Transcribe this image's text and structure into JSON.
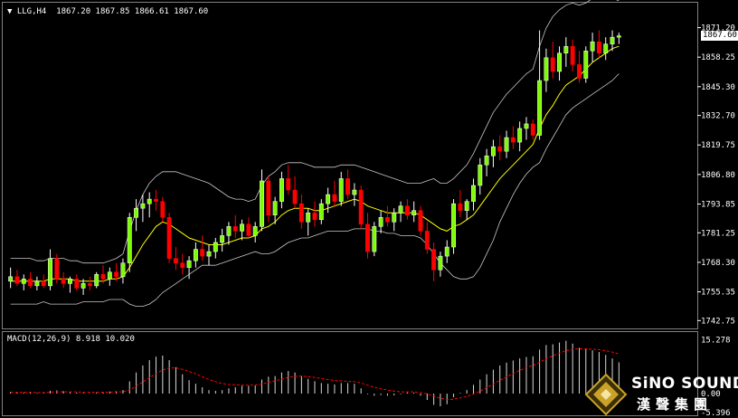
{
  "header": {
    "symbol_label": "LLG,H4",
    "ohlc_label": "1867.20 1867.85 1866.61 1867.60",
    "dropdown_marker": "▼"
  },
  "price_axis": {
    "ticks": [
      "1871.20",
      "1858.25",
      "1845.30",
      "1832.70",
      "1819.75",
      "1806.80",
      "1793.85",
      "1781.25",
      "1768.30",
      "1755.35",
      "1742.75"
    ],
    "tick_values": [
      1871.2,
      1858.25,
      1845.3,
      1832.7,
      1819.75,
      1806.8,
      1793.85,
      1781.25,
      1768.3,
      1755.35,
      1742.75
    ],
    "last_price": "1867.60",
    "ylim": [
      1740.5,
      1873.0
    ]
  },
  "macd": {
    "header_label": "MACD(12,26,9) 8.918 10.020",
    "ticks": [
      "15.278",
      "0.00",
      "-5.396"
    ],
    "tick_values": [
      15.278,
      0.0,
      -5.396
    ],
    "ylim": [
      -5.9,
      16.2
    ]
  },
  "colors": {
    "bull": "#ffffff",
    "bull_fill": "#7cfc00",
    "bear": "#ff0000",
    "ma": "#ffff00",
    "bands": "#c8c8c8",
    "signal": "#ff0000",
    "hist": "#d9d9d9",
    "frame": "#808080"
  },
  "logo": {
    "name": "SiNO SOUND",
    "chinese": "漢聲集團",
    "icon": "diamond-emblem-icon"
  },
  "chart_data": {
    "type": "candlestick",
    "candles": [
      {
        "o": 1760,
        "h": 1766,
        "l": 1757,
        "c": 1762
      },
      {
        "o": 1762,
        "h": 1765,
        "l": 1758,
        "c": 1759
      },
      {
        "o": 1759,
        "h": 1763,
        "l": 1756,
        "c": 1761
      },
      {
        "o": 1761,
        "h": 1764,
        "l": 1757,
        "c": 1758
      },
      {
        "o": 1758,
        "h": 1762,
        "l": 1756,
        "c": 1760
      },
      {
        "o": 1760,
        "h": 1763,
        "l": 1757,
        "c": 1758
      },
      {
        "o": 1758,
        "h": 1774,
        "l": 1756,
        "c": 1770
      },
      {
        "o": 1770,
        "h": 1772,
        "l": 1759,
        "c": 1761
      },
      {
        "o": 1761,
        "h": 1764,
        "l": 1757,
        "c": 1759
      },
      {
        "o": 1759,
        "h": 1762,
        "l": 1755,
        "c": 1761
      },
      {
        "o": 1761,
        "h": 1763,
        "l": 1756,
        "c": 1757
      },
      {
        "o": 1757,
        "h": 1761,
        "l": 1754,
        "c": 1759
      },
      {
        "o": 1759,
        "h": 1762,
        "l": 1756,
        "c": 1758
      },
      {
        "o": 1758,
        "h": 1764,
        "l": 1757,
        "c": 1763
      },
      {
        "o": 1763,
        "h": 1767,
        "l": 1759,
        "c": 1761
      },
      {
        "o": 1761,
        "h": 1766,
        "l": 1758,
        "c": 1764
      },
      {
        "o": 1764,
        "h": 1768,
        "l": 1760,
        "c": 1762
      },
      {
        "o": 1762,
        "h": 1770,
        "l": 1759,
        "c": 1768
      },
      {
        "o": 1768,
        "h": 1790,
        "l": 1764,
        "c": 1788
      },
      {
        "o": 1788,
        "h": 1796,
        "l": 1782,
        "c": 1792
      },
      {
        "o": 1792,
        "h": 1798,
        "l": 1786,
        "c": 1794
      },
      {
        "o": 1794,
        "h": 1799,
        "l": 1788,
        "c": 1796
      },
      {
        "o": 1796,
        "h": 1800,
        "l": 1791,
        "c": 1795
      },
      {
        "o": 1795,
        "h": 1797,
        "l": 1786,
        "c": 1788
      },
      {
        "o": 1788,
        "h": 1790,
        "l": 1768,
        "c": 1770
      },
      {
        "o": 1770,
        "h": 1775,
        "l": 1765,
        "c": 1768
      },
      {
        "o": 1768,
        "h": 1772,
        "l": 1763,
        "c": 1766
      },
      {
        "o": 1766,
        "h": 1771,
        "l": 1761,
        "c": 1769
      },
      {
        "o": 1769,
        "h": 1777,
        "l": 1766,
        "c": 1774
      },
      {
        "o": 1774,
        "h": 1780,
        "l": 1769,
        "c": 1771
      },
      {
        "o": 1771,
        "h": 1776,
        "l": 1767,
        "c": 1773
      },
      {
        "o": 1773,
        "h": 1779,
        "l": 1770,
        "c": 1777
      },
      {
        "o": 1777,
        "h": 1783,
        "l": 1773,
        "c": 1780
      },
      {
        "o": 1780,
        "h": 1786,
        "l": 1776,
        "c": 1784
      },
      {
        "o": 1784,
        "h": 1789,
        "l": 1779,
        "c": 1782
      },
      {
        "o": 1782,
        "h": 1787,
        "l": 1778,
        "c": 1785
      },
      {
        "o": 1785,
        "h": 1788,
        "l": 1779,
        "c": 1780
      },
      {
        "o": 1780,
        "h": 1786,
        "l": 1777,
        "c": 1784
      },
      {
        "o": 1784,
        "h": 1809,
        "l": 1782,
        "c": 1804
      },
      {
        "o": 1804,
        "h": 1806,
        "l": 1786,
        "c": 1789
      },
      {
        "o": 1789,
        "h": 1797,
        "l": 1785,
        "c": 1795
      },
      {
        "o": 1795,
        "h": 1808,
        "l": 1792,
        "c": 1805
      },
      {
        "o": 1805,
        "h": 1811,
        "l": 1798,
        "c": 1800
      },
      {
        "o": 1800,
        "h": 1806,
        "l": 1792,
        "c": 1794
      },
      {
        "o": 1794,
        "h": 1798,
        "l": 1783,
        "c": 1786
      },
      {
        "o": 1786,
        "h": 1792,
        "l": 1780,
        "c": 1790
      },
      {
        "o": 1790,
        "h": 1795,
        "l": 1784,
        "c": 1787
      },
      {
        "o": 1787,
        "h": 1796,
        "l": 1785,
        "c": 1794
      },
      {
        "o": 1794,
        "h": 1801,
        "l": 1790,
        "c": 1798
      },
      {
        "o": 1798,
        "h": 1804,
        "l": 1793,
        "c": 1795
      },
      {
        "o": 1795,
        "h": 1808,
        "l": 1793,
        "c": 1805
      },
      {
        "o": 1805,
        "h": 1809,
        "l": 1796,
        "c": 1798
      },
      {
        "o": 1798,
        "h": 1803,
        "l": 1793,
        "c": 1800
      },
      {
        "o": 1800,
        "h": 1802,
        "l": 1783,
        "c": 1785
      },
      {
        "o": 1785,
        "h": 1790,
        "l": 1770,
        "c": 1773
      },
      {
        "o": 1773,
        "h": 1786,
        "l": 1771,
        "c": 1784
      },
      {
        "o": 1784,
        "h": 1791,
        "l": 1781,
        "c": 1788
      },
      {
        "o": 1788,
        "h": 1793,
        "l": 1784,
        "c": 1786
      },
      {
        "o": 1786,
        "h": 1792,
        "l": 1782,
        "c": 1790
      },
      {
        "o": 1790,
        "h": 1795,
        "l": 1786,
        "c": 1793
      },
      {
        "o": 1793,
        "h": 1796,
        "l": 1787,
        "c": 1789
      },
      {
        "o": 1789,
        "h": 1795,
        "l": 1786,
        "c": 1791
      },
      {
        "o": 1791,
        "h": 1793,
        "l": 1780,
        "c": 1782
      },
      {
        "o": 1782,
        "h": 1786,
        "l": 1772,
        "c": 1774
      },
      {
        "o": 1774,
        "h": 1777,
        "l": 1760,
        "c": 1765
      },
      {
        "o": 1765,
        "h": 1773,
        "l": 1762,
        "c": 1771
      },
      {
        "o": 1771,
        "h": 1778,
        "l": 1768,
        "c": 1775
      },
      {
        "o": 1775,
        "h": 1796,
        "l": 1772,
        "c": 1794
      },
      {
        "o": 1794,
        "h": 1800,
        "l": 1788,
        "c": 1791
      },
      {
        "o": 1791,
        "h": 1796,
        "l": 1787,
        "c": 1795
      },
      {
        "o": 1795,
        "h": 1805,
        "l": 1791,
        "c": 1802
      },
      {
        "o": 1802,
        "h": 1814,
        "l": 1798,
        "c": 1811
      },
      {
        "o": 1811,
        "h": 1818,
        "l": 1806,
        "c": 1815
      },
      {
        "o": 1815,
        "h": 1822,
        "l": 1810,
        "c": 1819
      },
      {
        "o": 1819,
        "h": 1824,
        "l": 1813,
        "c": 1817
      },
      {
        "o": 1817,
        "h": 1826,
        "l": 1814,
        "c": 1823
      },
      {
        "o": 1823,
        "h": 1828,
        "l": 1818,
        "c": 1821
      },
      {
        "o": 1821,
        "h": 1830,
        "l": 1817,
        "c": 1827
      },
      {
        "o": 1827,
        "h": 1832,
        "l": 1822,
        "c": 1829
      },
      {
        "o": 1829,
        "h": 1831,
        "l": 1822,
        "c": 1824
      },
      {
        "o": 1824,
        "h": 1870,
        "l": 1822,
        "c": 1848
      },
      {
        "o": 1848,
        "h": 1862,
        "l": 1843,
        "c": 1858
      },
      {
        "o": 1858,
        "h": 1865,
        "l": 1849,
        "c": 1852
      },
      {
        "o": 1852,
        "h": 1863,
        "l": 1848,
        "c": 1860
      },
      {
        "o": 1860,
        "h": 1867,
        "l": 1854,
        "c": 1863
      },
      {
        "o": 1863,
        "h": 1866,
        "l": 1852,
        "c": 1855
      },
      {
        "o": 1855,
        "h": 1861,
        "l": 1847,
        "c": 1849
      },
      {
        "o": 1849,
        "h": 1863,
        "l": 1847,
        "c": 1861
      },
      {
        "o": 1861,
        "h": 1869,
        "l": 1856,
        "c": 1865
      },
      {
        "o": 1865,
        "h": 1870,
        "l": 1858,
        "c": 1860
      },
      {
        "o": 1860,
        "h": 1867,
        "l": 1857,
        "c": 1864
      },
      {
        "o": 1864,
        "h": 1870,
        "l": 1861,
        "c": 1867
      },
      {
        "o": 1867,
        "h": 1869,
        "l": 1864,
        "c": 1867.6
      }
    ],
    "bb_upper": [
      1770,
      1770,
      1770,
      1770,
      1769,
      1769,
      1770,
      1770,
      1770,
      1769,
      1769,
      1768,
      1768,
      1768,
      1768,
      1769,
      1770,
      1772,
      1782,
      1791,
      1798,
      1803,
      1806,
      1808,
      1808,
      1808,
      1807,
      1806,
      1805,
      1804,
      1803,
      1801,
      1799,
      1797,
      1796,
      1796,
      1795,
      1796,
      1802,
      1806,
      1808,
      1811,
      1812,
      1812,
      1812,
      1811,
      1810,
      1810,
      1810,
      1810,
      1811,
      1811,
      1811,
      1810,
      1809,
      1808,
      1807,
      1806,
      1805,
      1804,
      1803,
      1803,
      1803,
      1804,
      1805,
      1803,
      1803,
      1805,
      1808,
      1811,
      1816,
      1822,
      1828,
      1834,
      1838,
      1842,
      1845,
      1848,
      1851,
      1853,
      1863,
      1871,
      1876,
      1879,
      1881,
      1882,
      1881,
      1882,
      1884,
      1885,
      1885,
      1884,
      1883
    ],
    "bb_lower": [
      1750,
      1750,
      1750,
      1750,
      1750,
      1751,
      1750,
      1750,
      1750,
      1750,
      1750,
      1751,
      1751,
      1751,
      1751,
      1752,
      1752,
      1752,
      1750,
      1749,
      1749,
      1750,
      1752,
      1755,
      1757,
      1759,
      1761,
      1763,
      1765,
      1767,
      1767,
      1767,
      1768,
      1769,
      1770,
      1771,
      1772,
      1773,
      1772,
      1772,
      1773,
      1775,
      1777,
      1778,
      1779,
      1779,
      1780,
      1781,
      1782,
      1782,
      1782,
      1782,
      1783,
      1783,
      1783,
      1782,
      1782,
      1781,
      1781,
      1780,
      1780,
      1780,
      1779,
      1776,
      1772,
      1768,
      1765,
      1762,
      1761,
      1761,
      1762,
      1766,
      1772,
      1778,
      1786,
      1792,
      1798,
      1803,
      1807,
      1810,
      1812,
      1818,
      1823,
      1828,
      1833,
      1836,
      1838,
      1840,
      1842,
      1844,
      1846,
      1848,
      1851
    ],
    "ma": [
      1760,
      1760,
      1760,
      1760,
      1760,
      1760,
      1761,
      1761,
      1761,
      1761,
      1760,
      1760,
      1760,
      1760,
      1760,
      1761,
      1761,
      1762,
      1766,
      1771,
      1776,
      1780,
      1784,
      1786,
      1785,
      1783,
      1781,
      1779,
      1778,
      1777,
      1776,
      1776,
      1776,
      1777,
      1778,
      1779,
      1779,
      1780,
      1783,
      1784,
      1786,
      1789,
      1791,
      1792,
      1792,
      1792,
      1791,
      1791,
      1792,
      1793,
      1794,
      1795,
      1796,
      1795,
      1793,
      1792,
      1791,
      1790,
      1790,
      1790,
      1790,
      1790,
      1789,
      1787,
      1785,
      1783,
      1782,
      1784,
      1785,
      1787,
      1789,
      1793,
      1797,
      1801,
      1805,
      1808,
      1811,
      1814,
      1817,
      1820,
      1827,
      1833,
      1837,
      1842,
      1846,
      1848,
      1850,
      1853,
      1856,
      1858,
      1860,
      1862,
      1863
    ],
    "macd_hist": [
      0.5,
      0.4,
      0.3,
      0.3,
      0.2,
      0.2,
      0.8,
      0.9,
      0.7,
      0.5,
      0.3,
      0.2,
      0.1,
      0.3,
      0.4,
      0.6,
      0.7,
      1.0,
      3.5,
      6.0,
      8.0,
      9.5,
      10.5,
      10.8,
      9.5,
      7.5,
      5.5,
      3.8,
      2.8,
      1.8,
      1.0,
      0.8,
      1.0,
      1.5,
      1.8,
      2.2,
      2.2,
      2.3,
      4.0,
      4.8,
      5.0,
      6.0,
      6.4,
      6.0,
      5.0,
      4.2,
      3.5,
      3.0,
      2.8,
      2.6,
      3.0,
      3.0,
      2.8,
      1.5,
      -0.2,
      -0.6,
      -0.4,
      -0.6,
      -0.5,
      -0.2,
      0.3,
      0.3,
      -0.6,
      -1.8,
      -3.2,
      -3.6,
      -3.0,
      -1.0,
      0.2,
      1.0,
      2.5,
      4.0,
      5.5,
      6.8,
      8.0,
      8.8,
      9.4,
      10.0,
      10.4,
      10.6,
      12.5,
      13.8,
      14.0,
      14.5,
      15.0,
      14.2,
      13.0,
      12.8,
      12.3,
      11.8,
      11.0,
      10.0,
      8.9
    ],
    "macd_signal": [
      0.4,
      0.4,
      0.4,
      0.4,
      0.3,
      0.3,
      0.4,
      0.5,
      0.5,
      0.5,
      0.5,
      0.4,
      0.4,
      0.4,
      0.4,
      0.4,
      0.5,
      0.5,
      1.1,
      2.1,
      3.3,
      4.5,
      5.7,
      6.7,
      7.3,
      7.3,
      6.9,
      6.3,
      5.6,
      4.8,
      4.0,
      3.4,
      2.9,
      2.6,
      2.5,
      2.4,
      2.4,
      2.4,
      2.7,
      3.2,
      3.6,
      4.1,
      4.6,
      4.9,
      5.0,
      4.8,
      4.6,
      4.3,
      4.0,
      3.7,
      3.6,
      3.5,
      3.4,
      3.0,
      2.4,
      1.8,
      1.4,
      1.0,
      0.7,
      0.5,
      0.5,
      0.5,
      0.3,
      -0.1,
      -0.7,
      -1.3,
      -1.7,
      -1.6,
      -1.2,
      -0.8,
      -0.1,
      0.7,
      1.7,
      2.7,
      3.8,
      4.8,
      5.7,
      6.6,
      7.4,
      8.0,
      8.9,
      9.9,
      10.7,
      11.5,
      12.2,
      12.6,
      12.7,
      12.7,
      12.6,
      12.5,
      12.2,
      11.8,
      11.3
    ]
  }
}
